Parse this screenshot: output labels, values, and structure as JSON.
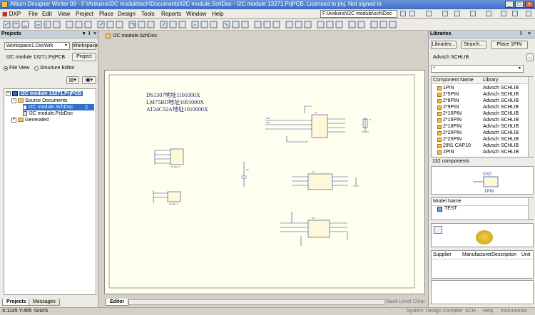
{
  "window": {
    "title": "Altium Designer Winter 09 - F:\\Arduino\\I2C module\\sch\\Documents\\I2C module.SchDoc - I2C module 13271.PrjPCB. Licensed to jmj. Not signed in."
  },
  "menu": {
    "items": [
      "DXP",
      "File",
      "Edit",
      "View",
      "Project",
      "Place",
      "Design",
      "Tools",
      "Reports",
      "Window",
      "Help"
    ],
    "path": "F:\\Arduino\\I2C module\\sch\\Doc"
  },
  "projects_panel": {
    "title": "Projects",
    "workspace_value": "Workspace1.DsnWrk",
    "workspace_button": "Workspace",
    "project_value": "I2C module 13271.PrjPCB",
    "project_button": "Project",
    "view_file": "File View",
    "view_structure": "Structure Editor",
    "tree": {
      "project": "I2C module 13271.PrjPCB",
      "source_documents": "Source Documents",
      "schdoc": "I2C module.SchDoc",
      "pcbdoc": "I2C module.PcbDoc",
      "generated": "Generated"
    }
  },
  "bottom_tabs": {
    "projects": "Projects",
    "messages": "Messages",
    "editor": "Editor"
  },
  "document": {
    "tab_label": "I2C module.SchDoc",
    "note_lines": [
      "DS1307地址1101000X",
      "LM75BD地址1001000X",
      "AT24C32A地址1010000X"
    ],
    "mask_level": "Mask Level",
    "clear": "Clear"
  },
  "libraries_panel": {
    "title": "Libraries",
    "libraries_button": "Libraries...",
    "search_button": "Search...",
    "place_button": "Place 1PIN",
    "library_value": "Advsch SCHLIB",
    "filter_value": "*",
    "col_component": "Component Name",
    "col_library": "Library",
    "components": [
      {
        "name": "1PIN",
        "lib": "Advsch SCHLIB"
      },
      {
        "name": "2*5PIN",
        "lib": "Advsch SCHLIB"
      },
      {
        "name": "2*8PIN",
        "lib": "Advsch SCHLIB"
      },
      {
        "name": "2*9PIN",
        "lib": "Advsch SCHLIB"
      },
      {
        "name": "2*10PIN",
        "lib": "Advsch SCHLIB"
      },
      {
        "name": "2*15PIN",
        "lib": "Advsch SCHLIB"
      },
      {
        "name": "2*18PIN",
        "lib": "Advsch SCHLIB"
      },
      {
        "name": "2*20PIN",
        "lib": "Advsch SCHLIB"
      },
      {
        "name": "2*25PIN",
        "lib": "Advsch SCHLIB"
      },
      {
        "name": "2IN1 CAP10",
        "lib": "Advsch SCHLIB"
      },
      {
        "name": "2PIN",
        "lib": "Advsch SCHLIB"
      }
    ],
    "count": "132 components",
    "preview_label_top": "CN?",
    "preview_label_bottom": "1PIN",
    "col_model_name": "Model Name",
    "model_item": "TEST",
    "col_supplier": "Supplier",
    "col_manufacturer": "Manufacturer",
    "col_description": "Description",
    "col_unit": "Unit"
  },
  "status": {
    "coords": "X:1145 Y:455",
    "grid": "Grid:5",
    "right_items": [
      "System",
      "Design Compiler",
      "SCH",
      "Help",
      "Instruments"
    ]
  }
}
